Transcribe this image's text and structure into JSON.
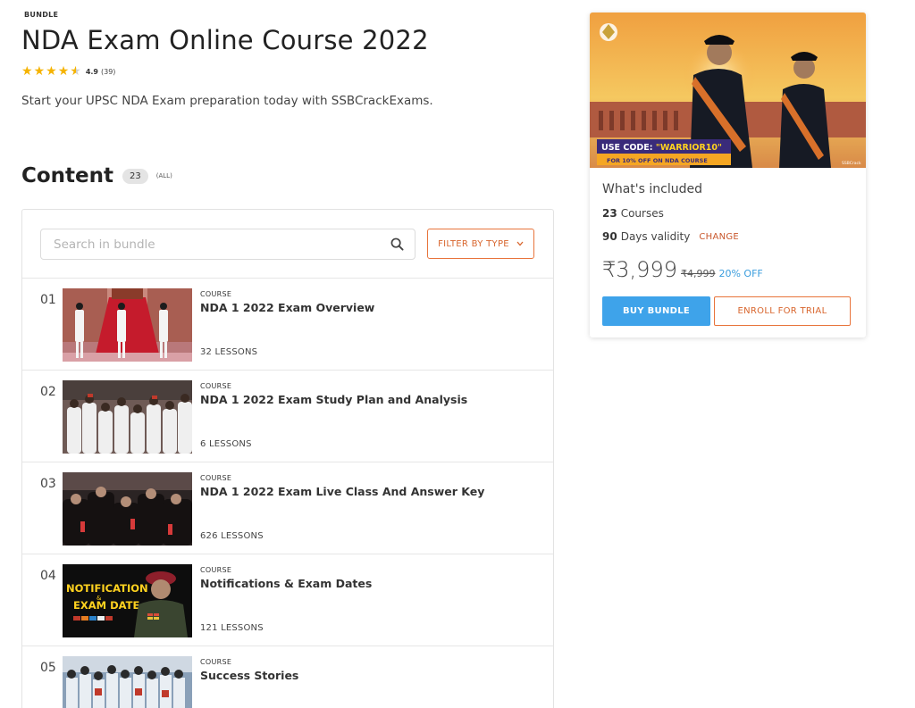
{
  "header": {
    "kicker": "BUNDLE",
    "title": "NDA Exam Online Course 2022",
    "rating_score": "4.9",
    "rating_count": "(39)",
    "rating_value": 4.9,
    "subtitle": "Start your UPSC NDA Exam preparation today with SSBCrackExams."
  },
  "content": {
    "title": "Content",
    "count": "23",
    "all_label": "(ALL)"
  },
  "search": {
    "placeholder": "Search in bundle",
    "value": ""
  },
  "filter": {
    "label": "FILTER BY TYPE"
  },
  "rows": [
    {
      "num": "01",
      "kicker": "COURSE",
      "title": "NDA 1 2022 Exam Overview",
      "lessons": "32 LESSONS"
    },
    {
      "num": "02",
      "kicker": "COURSE",
      "title": "NDA 1 2022 Exam Study Plan and Analysis",
      "lessons": "6 LESSONS"
    },
    {
      "num": "03",
      "kicker": "COURSE",
      "title": "NDA 1 2022 Exam Live Class And Answer Key",
      "lessons": "626 LESSONS"
    },
    {
      "num": "04",
      "kicker": "COURSE",
      "title": "Notifications & Exam Dates",
      "lessons": "121 LESSONS"
    },
    {
      "num": "05",
      "kicker": "COURSE",
      "title": "Success Stories",
      "lessons": ""
    }
  ],
  "thumbs": {
    "notification_line1": "NOTIFICATION",
    "notification_amp": "&",
    "notification_line2": "EXAM DATE"
  },
  "card": {
    "banner_code_prefix": "USE CODE: ",
    "banner_code": "\"WARRIOR10\"",
    "banner_offer": "FOR 10% OFF ON NDA COURSE",
    "banner_credit": "SSBCrack",
    "included_title": "What's included",
    "courses_count": "23",
    "courses_label": "Courses",
    "validity_count": "90",
    "validity_label": "Days validity",
    "change_label": "CHANGE",
    "price": "₹3,999",
    "old_price": "₹4,999",
    "discount": "20% OFF",
    "buy_label": "BUY BUNDLE",
    "trial_label": "ENROLL FOR TRIAL"
  },
  "colors": {
    "accent_orange": "#e8743b",
    "accent_blue": "#3ea3ea",
    "star": "#f5b300"
  }
}
